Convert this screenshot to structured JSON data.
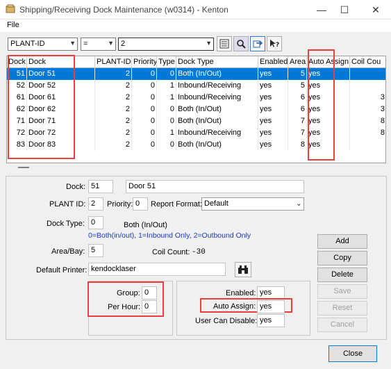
{
  "window": {
    "title": "Shipping/Receiving Dock Maintenance (w0314) - Kenton",
    "controls": {
      "minimize": "—",
      "maximize": "☐",
      "close": "✕"
    }
  },
  "menu": {
    "file": "File"
  },
  "filter": {
    "field": "PLANT-ID",
    "operator": "=",
    "value": "2",
    "icons": [
      "list-icon",
      "search-icon",
      "refresh-icon",
      "help-icon"
    ]
  },
  "grid": {
    "columns": [
      "Dock",
      "Dock",
      "PLANT-ID",
      "Priority",
      "Type",
      "Dock Type",
      "Enabled",
      "Area",
      "Auto Assign",
      "Coil Cou"
    ],
    "rows": [
      {
        "dock": "51",
        "name": "Door 51",
        "plant": "2",
        "priority": "0",
        "type": "0",
        "dock_type": "Both (In/Out)",
        "enabled": "yes",
        "area": "5",
        "auto": "yes",
        "coil": ""
      },
      {
        "dock": "52",
        "name": "Door 52",
        "plant": "2",
        "priority": "0",
        "type": "1",
        "dock_type": "Inbound/Receiving",
        "enabled": "yes",
        "area": "5",
        "auto": "yes",
        "coil": ""
      },
      {
        "dock": "61",
        "name": "Door 61",
        "plant": "2",
        "priority": "0",
        "type": "1",
        "dock_type": "Inbound/Receiving",
        "enabled": "yes",
        "area": "6",
        "auto": "yes",
        "coil": "3"
      },
      {
        "dock": "62",
        "name": "Door 62",
        "plant": "2",
        "priority": "0",
        "type": "0",
        "dock_type": "Both (In/Out)",
        "enabled": "yes",
        "area": "6",
        "auto": "yes",
        "coil": "3"
      },
      {
        "dock": "71",
        "name": "Door 71",
        "plant": "2",
        "priority": "0",
        "type": "0",
        "dock_type": "Both (In/Out)",
        "enabled": "yes",
        "area": "7",
        "auto": "yes",
        "coil": "8"
      },
      {
        "dock": "72",
        "name": "Door 72",
        "plant": "2",
        "priority": "0",
        "type": "1",
        "dock_type": "Inbound/Receiving",
        "enabled": "yes",
        "area": "7",
        "auto": "yes",
        "coil": "8"
      },
      {
        "dock": "83",
        "name": "Door 83",
        "plant": "2",
        "priority": "0",
        "type": "0",
        "dock_type": "Both (In/Out)",
        "enabled": "yes",
        "area": "8",
        "auto": "yes",
        "coil": ""
      }
    ],
    "selected_row": 0
  },
  "details": {
    "dock_label": "Dock:",
    "dock_value": "51",
    "dock_name": "Door 51",
    "plant_label": "PLANT ID:",
    "plant_value": "2",
    "priority_label": "Priority:",
    "priority_value": "0",
    "report_format_label": "Report Format:",
    "report_format_value": "Default",
    "dock_type_label": "Dock Type:",
    "dock_type_value": "0",
    "dock_type_desc": "Both (In/Out)",
    "dock_type_hint": "0=Both(in/out), 1=Inbound Only, 2=Outbound Only",
    "area_label": "Area/Bay:",
    "area_value": "5",
    "coil_count_label": "Coil Count:",
    "coil_count_value": "-30",
    "printer_label": "Default Printer:",
    "printer_value": "kendocklaser",
    "group_label": "Group:",
    "group_value": "0",
    "per_hour_label": "Per Hour:",
    "per_hour_value": "0",
    "enabled_label": "Enabled:",
    "enabled_value": "yes",
    "auto_assign_label": "Auto Assign:",
    "auto_assign_value": "yes",
    "user_disable_label": "User Can Disable:",
    "user_disable_value": "yes"
  },
  "buttons": {
    "add": "Add",
    "copy": "Copy",
    "delete": "Delete",
    "save": "Save",
    "reset": "Reset",
    "cancel": "Cancel",
    "close": "Close"
  },
  "colors": {
    "selection": "#0078d7",
    "annotation": "#e84040",
    "hint": "#1a3ac0"
  }
}
